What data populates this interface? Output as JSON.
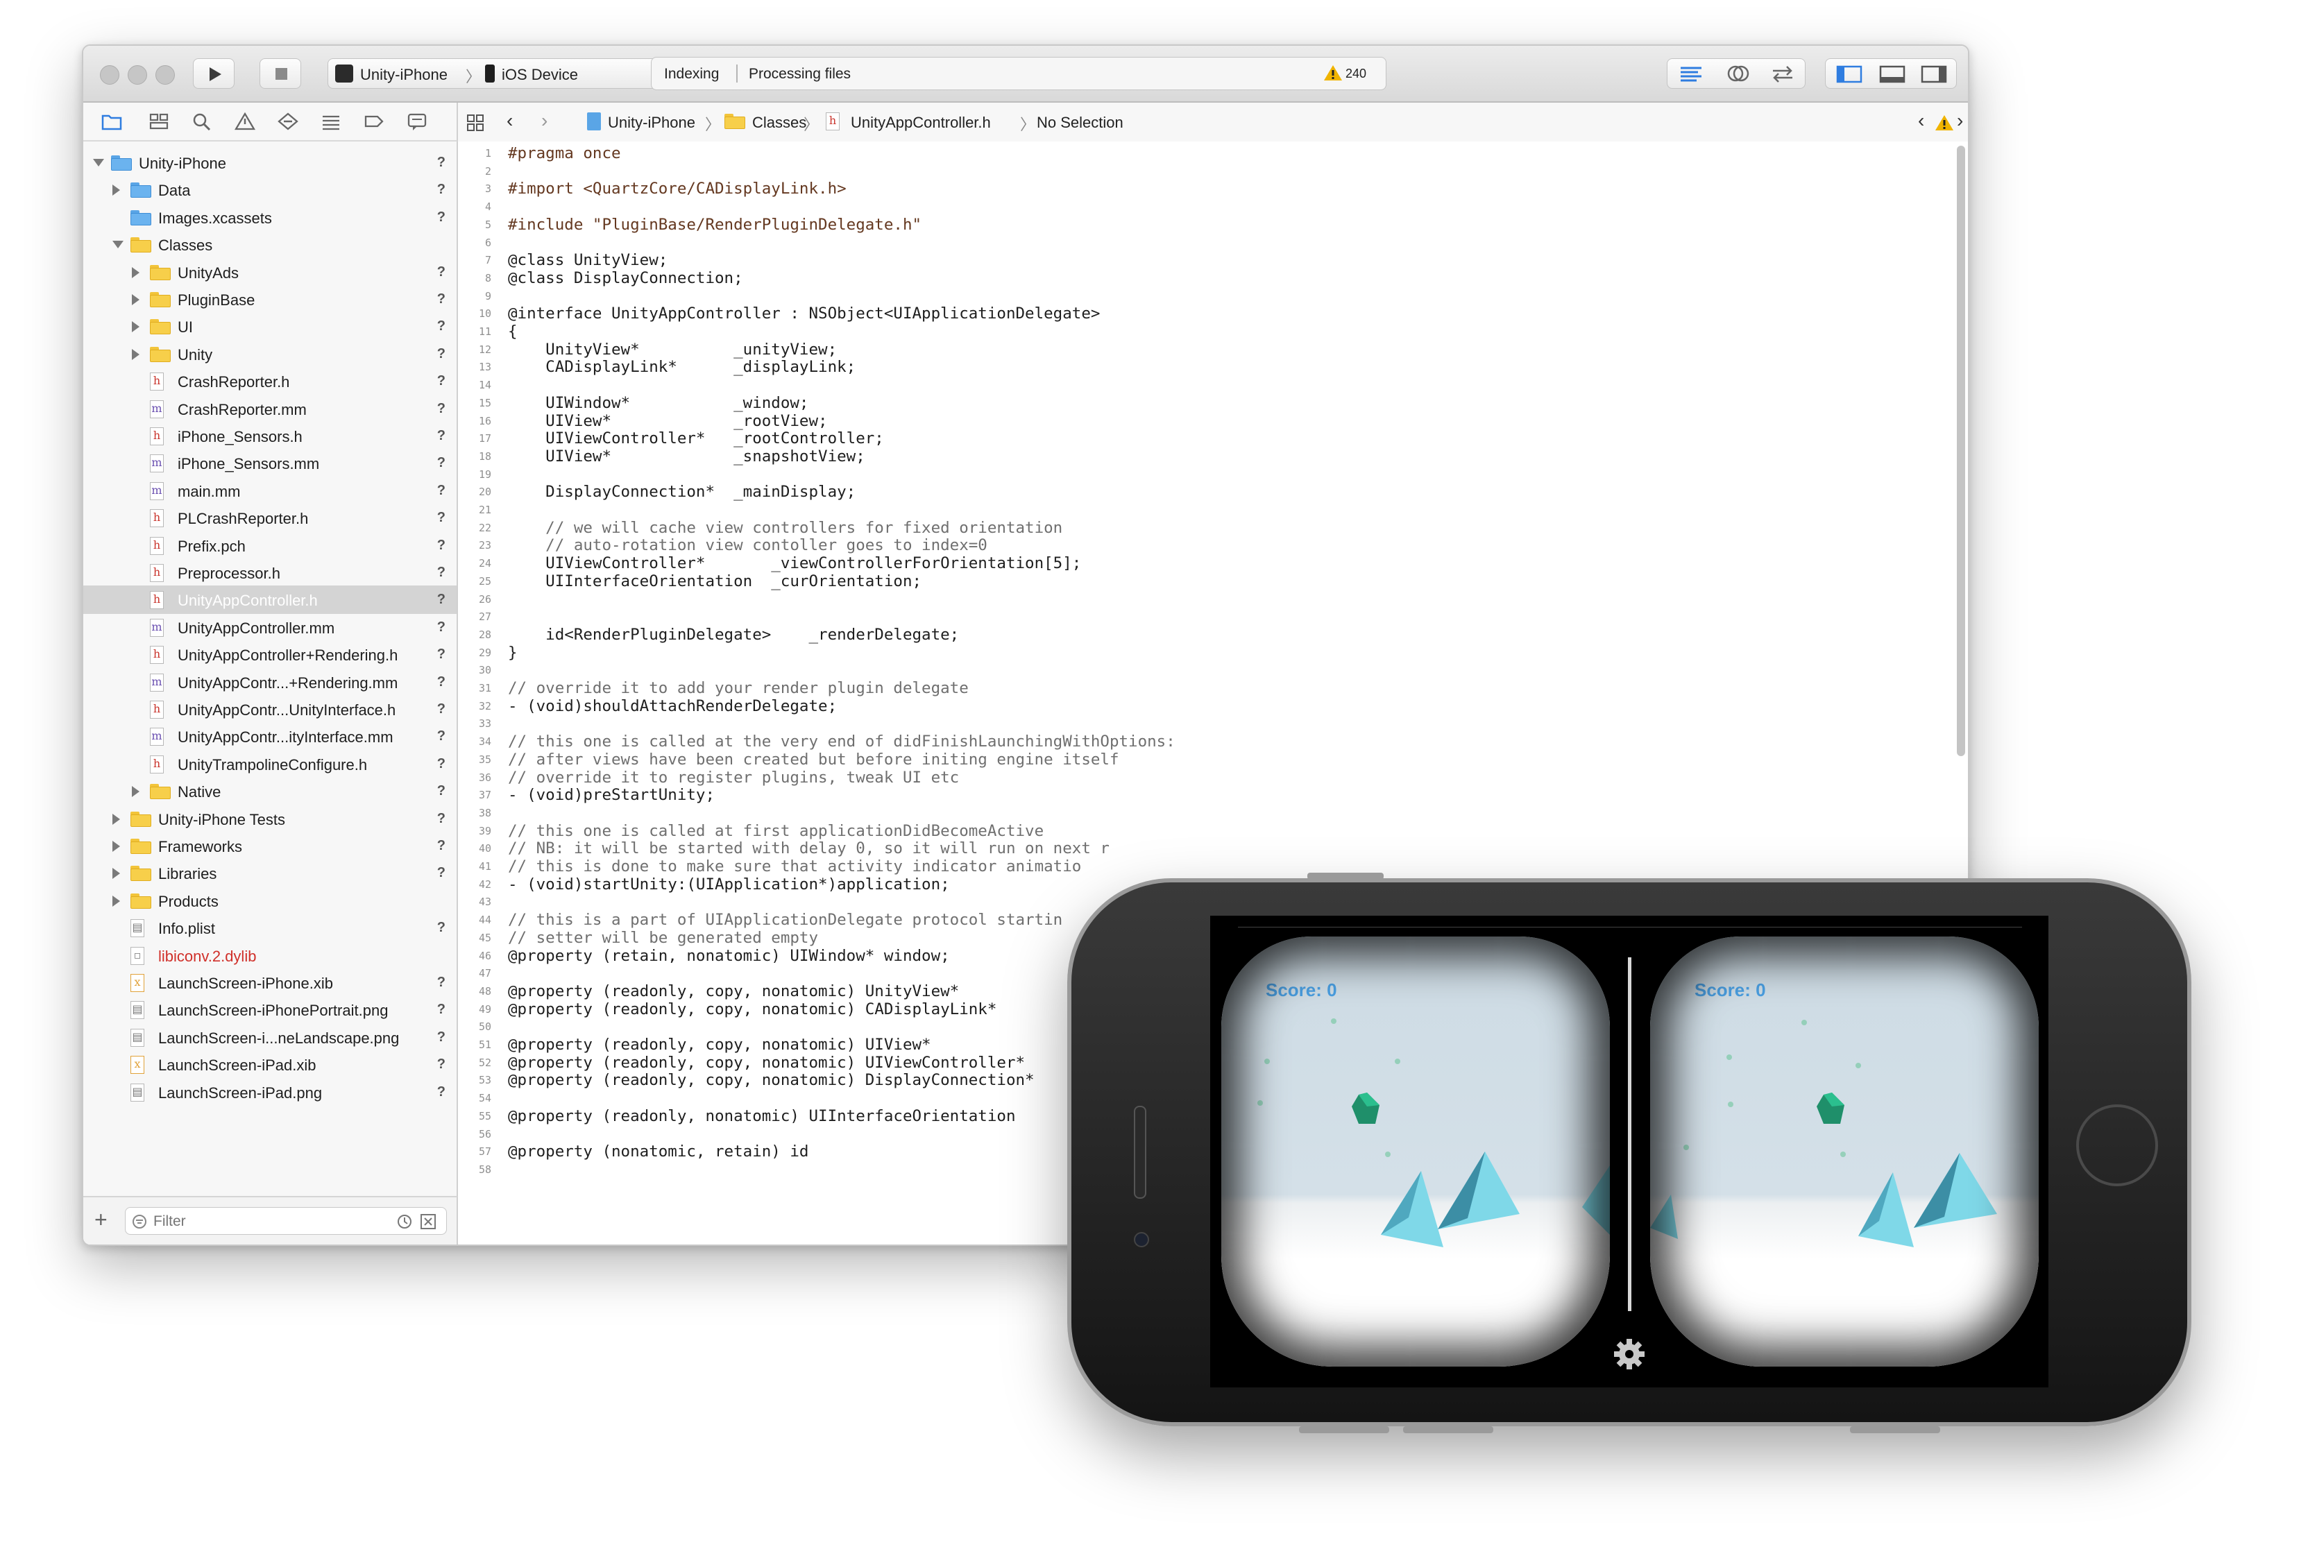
{
  "toolbar": {
    "scheme": "Unity-iPhone",
    "device": "iOS Device",
    "activity_status": "Indexing",
    "activity_detail": "Processing files",
    "warning_count": "240"
  },
  "jumpbar": {
    "crumbs": [
      "Unity-iPhone",
      "Classes",
      "UnityAppController.h",
      "No Selection"
    ]
  },
  "filter": {
    "placeholder": "Filter"
  },
  "navigator": {
    "rows": [
      {
        "label": "Unity-iPhone",
        "q": "?"
      },
      {
        "label": "Data",
        "q": "?"
      },
      {
        "label": "Images.xcassets",
        "q": "?"
      },
      {
        "label": "Classes",
        "q": ""
      },
      {
        "label": "UnityAds",
        "q": "?"
      },
      {
        "label": "PluginBase",
        "q": "?"
      },
      {
        "label": "UI",
        "q": "?"
      },
      {
        "label": "Unity",
        "q": "?"
      },
      {
        "label": "CrashReporter.h",
        "q": "?"
      },
      {
        "label": "CrashReporter.mm",
        "q": "?"
      },
      {
        "label": "iPhone_Sensors.h",
        "q": "?"
      },
      {
        "label": "iPhone_Sensors.mm",
        "q": "?"
      },
      {
        "label": "main.mm",
        "q": "?"
      },
      {
        "label": "PLCrashReporter.h",
        "q": "?"
      },
      {
        "label": "Prefix.pch",
        "q": "?"
      },
      {
        "label": "Preprocessor.h",
        "q": "?"
      },
      {
        "label": "UnityAppController.h",
        "q": "?"
      },
      {
        "label": "UnityAppController.mm",
        "q": "?"
      },
      {
        "label": "UnityAppController+Rendering.h",
        "q": "?"
      },
      {
        "label": "UnityAppContr...+Rendering.mm",
        "q": "?"
      },
      {
        "label": "UnityAppContr...UnityInterface.h",
        "q": "?"
      },
      {
        "label": "UnityAppContr...ityInterface.mm",
        "q": "?"
      },
      {
        "label": "UnityTrampolineConfigure.h",
        "q": "?"
      },
      {
        "label": "Native",
        "q": "?"
      },
      {
        "label": "Unity-iPhone Tests",
        "q": "?"
      },
      {
        "label": "Frameworks",
        "q": "?"
      },
      {
        "label": "Libraries",
        "q": "?"
      },
      {
        "label": "Products",
        "q": ""
      },
      {
        "label": "Info.plist",
        "q": "?"
      },
      {
        "label": "libiconv.2.dylib",
        "q": ""
      },
      {
        "label": "LaunchScreen-iPhone.xib",
        "q": "?"
      },
      {
        "label": "LaunchScreen-iPhonePortrait.png",
        "q": "?"
      },
      {
        "label": "LaunchScreen-i...neLandscape.png",
        "q": "?"
      },
      {
        "label": "LaunchScreen-iPad.xib",
        "q": "?"
      },
      {
        "label": "LaunchScreen-iPad.png",
        "q": "?"
      }
    ]
  },
  "editor": {
    "lines": [
      "#pragma once",
      "",
      "#import <QuartzCore/CADisplayLink.h>",
      "",
      "#include \"PluginBase/RenderPluginDelegate.h\"",
      "",
      "@class UnityView;",
      "@class DisplayConnection;",
      "",
      "@interface UnityAppController : NSObject<UIApplicationDelegate>",
      "{",
      "    UnityView*          _unityView;",
      "    CADisplayLink*      _displayLink;",
      "",
      "    UIWindow*           _window;",
      "    UIView*             _rootView;",
      "    UIViewController*   _rootController;",
      "    UIView*             _snapshotView;",
      "",
      "    DisplayConnection*  _mainDisplay;",
      "",
      "    // we will cache view controllers for fixed orientation",
      "    // auto-rotation view contoller goes to index=0",
      "    UIViewController*       _viewControllerForOrientation[5];",
      "    UIInterfaceOrientation  _curOrientation;",
      "",
      "",
      "    id<RenderPluginDelegate>    _renderDelegate;",
      "}",
      "",
      "// override it to add your render plugin delegate",
      "- (void)shouldAttachRenderDelegate;",
      "",
      "// this one is called at the very end of didFinishLaunchingWithOptions:",
      "// after views have been created but before initing engine itself",
      "// override it to register plugins, tweak UI etc",
      "- (void)preStartUnity;",
      "",
      "// this one is called at first applicationDidBecomeActive",
      "// NB: it will be started with delay 0, so it will run on next r",
      "// this is done to make sure that activity indicator animatio",
      "- (void)startUnity:(UIApplication*)application;",
      "",
      "// this is a part of UIApplicationDelegate protocol startin",
      "// setter will be generated empty",
      "@property (retain, nonatomic) UIWindow* window;",
      "",
      "@property (readonly, copy, nonatomic) UnityView*",
      "@property (readonly, copy, nonatomic) CADisplayLink*",
      "",
      "@property (readonly, copy, nonatomic) UIView*",
      "@property (readonly, copy, nonatomic) UIViewController*",
      "@property (readonly, copy, nonatomic) DisplayConnection*",
      "",
      "@property (readonly, nonatomic) UIInterfaceOrientation",
      "",
      "@property (nonatomic, retain) id",
      ""
    ]
  },
  "game": {
    "score_left": "Score: 0",
    "score_right": "Score: 0"
  },
  "colors": {
    "accent": "#4a9ee0",
    "warning": "#f0b400",
    "selection": "#d4d4d4",
    "crystal": "#1f8f6a",
    "pyramid": "#7fd8e8"
  }
}
